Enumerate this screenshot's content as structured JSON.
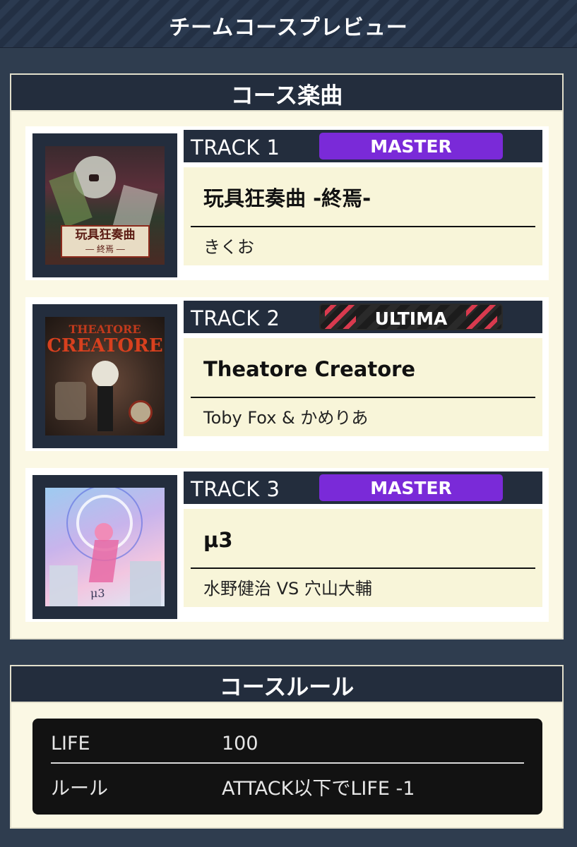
{
  "header": {
    "title": "チームコースプレビュー"
  },
  "songs_section": {
    "title": "コース楽曲",
    "tracks": [
      {
        "track_label": "TRACK 1",
        "difficulty": "MASTER",
        "difficulty_color": "#7a2ad8",
        "song_title": "玩具狂奏曲 -終焉-",
        "artist": "きくお",
        "jacket_caption_1": "玩具狂奏曲",
        "jacket_caption_2": "― 終焉 ―"
      },
      {
        "track_label": "TRACK 2",
        "difficulty": "ULTIMA",
        "difficulty_color": "#d93a4e",
        "song_title": "Theatore Creatore",
        "artist": "Toby Fox & かめりあ",
        "jacket_caption_1": "THEATORE",
        "jacket_caption_2": "CREATORE"
      },
      {
        "track_label": "TRACK 3",
        "difficulty": "MASTER",
        "difficulty_color": "#7a2ad8",
        "song_title": "μ3",
        "artist": "水野健治 VS 穴山大輔",
        "jacket_caption_1": "μ3"
      }
    ]
  },
  "rules_section": {
    "title": "コースルール",
    "rows": [
      {
        "key": "LIFE",
        "value": "100"
      },
      {
        "key": "ルール",
        "value": "ATTACK以下でLIFE -1"
      }
    ]
  }
}
